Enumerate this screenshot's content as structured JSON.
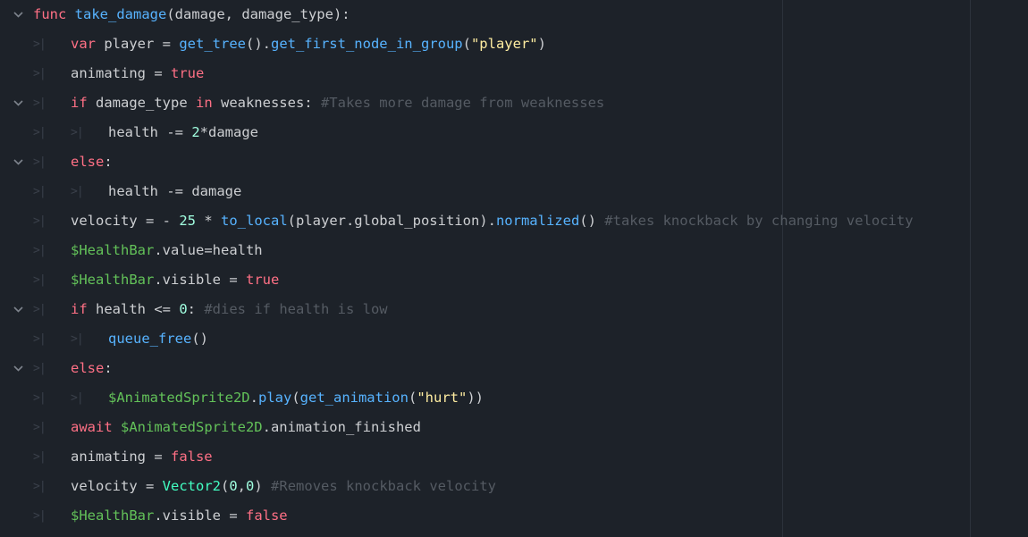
{
  "colors": {
    "background": "#1d2229",
    "text": "#cdcfd2",
    "keyword": "#ff7085",
    "function": "#57b3ff",
    "string": "#ffeda1",
    "number": "#a1ffe0",
    "comment": "#555b63",
    "node_path": "#63c259",
    "builtin_type": "#42ffc2",
    "tab_marker": "#3a404a"
  },
  "icons": {
    "fold": "chevron-down-icon",
    "tab": "tab-indent-marker"
  },
  "tab_glyph": ">|",
  "lines": [
    {
      "indent": 0,
      "fold": true,
      "tokens": [
        {
          "t": "func ",
          "c": "kw"
        },
        {
          "t": "take_damage",
          "c": "fn"
        },
        {
          "t": "(damage, damage_type):",
          "c": "txt"
        }
      ]
    },
    {
      "indent": 1,
      "fold": false,
      "tokens": [
        {
          "t": "var ",
          "c": "kw"
        },
        {
          "t": "player = ",
          "c": "txt"
        },
        {
          "t": "get_tree",
          "c": "fn"
        },
        {
          "t": "().",
          "c": "txt"
        },
        {
          "t": "get_first_node_in_group",
          "c": "fn"
        },
        {
          "t": "(",
          "c": "txt"
        },
        {
          "t": "\"player\"",
          "c": "str"
        },
        {
          "t": ")",
          "c": "txt"
        }
      ]
    },
    {
      "indent": 1,
      "fold": false,
      "tokens": [
        {
          "t": "animating = ",
          "c": "txt"
        },
        {
          "t": "true",
          "c": "kw"
        }
      ]
    },
    {
      "indent": 1,
      "fold": true,
      "tokens": [
        {
          "t": "if ",
          "c": "kw"
        },
        {
          "t": "damage_type ",
          "c": "txt"
        },
        {
          "t": "in ",
          "c": "kw"
        },
        {
          "t": "weaknesses: ",
          "c": "txt"
        },
        {
          "t": "#Takes more damage from weaknesses",
          "c": "cm"
        }
      ]
    },
    {
      "indent": 2,
      "fold": false,
      "tokens": [
        {
          "t": "health -= ",
          "c": "txt"
        },
        {
          "t": "2",
          "c": "num"
        },
        {
          "t": "*damage",
          "c": "txt"
        }
      ]
    },
    {
      "indent": 1,
      "fold": true,
      "tokens": [
        {
          "t": "else",
          "c": "kw"
        },
        {
          "t": ":",
          "c": "txt"
        }
      ]
    },
    {
      "indent": 2,
      "fold": false,
      "tokens": [
        {
          "t": "health -= damage",
          "c": "txt"
        }
      ]
    },
    {
      "indent": 1,
      "fold": false,
      "tokens": [
        {
          "t": "velocity = - ",
          "c": "txt"
        },
        {
          "t": "25",
          "c": "num"
        },
        {
          "t": " * ",
          "c": "txt"
        },
        {
          "t": "to_local",
          "c": "fn"
        },
        {
          "t": "(player.global_position).",
          "c": "txt"
        },
        {
          "t": "normalized",
          "c": "fn"
        },
        {
          "t": "() ",
          "c": "txt"
        },
        {
          "t": "#takes knockback by changing velocity",
          "c": "cm"
        }
      ]
    },
    {
      "indent": 1,
      "fold": false,
      "tokens": [
        {
          "t": "$HealthBar",
          "c": "node"
        },
        {
          "t": ".value=health",
          "c": "txt"
        }
      ]
    },
    {
      "indent": 1,
      "fold": false,
      "tokens": [
        {
          "t": "$HealthBar",
          "c": "node"
        },
        {
          "t": ".visible = ",
          "c": "txt"
        },
        {
          "t": "true",
          "c": "kw"
        }
      ]
    },
    {
      "indent": 1,
      "fold": true,
      "tokens": [
        {
          "t": "if ",
          "c": "kw"
        },
        {
          "t": "health <= ",
          "c": "txt"
        },
        {
          "t": "0",
          "c": "num"
        },
        {
          "t": ": ",
          "c": "txt"
        },
        {
          "t": "#dies if health is low",
          "c": "cm"
        }
      ]
    },
    {
      "indent": 2,
      "fold": false,
      "tokens": [
        {
          "t": "queue_free",
          "c": "fn"
        },
        {
          "t": "()",
          "c": "txt"
        }
      ]
    },
    {
      "indent": 1,
      "fold": true,
      "tokens": [
        {
          "t": "else",
          "c": "kw"
        },
        {
          "t": ":",
          "c": "txt"
        }
      ]
    },
    {
      "indent": 2,
      "fold": false,
      "tokens": [
        {
          "t": "$AnimatedSprite2D",
          "c": "node"
        },
        {
          "t": ".",
          "c": "txt"
        },
        {
          "t": "play",
          "c": "fn"
        },
        {
          "t": "(",
          "c": "txt"
        },
        {
          "t": "get_animation",
          "c": "fn"
        },
        {
          "t": "(",
          "c": "txt"
        },
        {
          "t": "\"hurt\"",
          "c": "str"
        },
        {
          "t": "))",
          "c": "txt"
        }
      ]
    },
    {
      "indent": 1,
      "fold": false,
      "tokens": [
        {
          "t": "await ",
          "c": "kw"
        },
        {
          "t": "$AnimatedSprite2D",
          "c": "node"
        },
        {
          "t": ".animation_finished",
          "c": "txt"
        }
      ]
    },
    {
      "indent": 1,
      "fold": false,
      "tokens": [
        {
          "t": "animating = ",
          "c": "txt"
        },
        {
          "t": "false",
          "c": "kw"
        }
      ]
    },
    {
      "indent": 1,
      "fold": false,
      "tokens": [
        {
          "t": "velocity = ",
          "c": "txt"
        },
        {
          "t": "Vector2",
          "c": "type"
        },
        {
          "t": "(",
          "c": "txt"
        },
        {
          "t": "0",
          "c": "num"
        },
        {
          "t": ",",
          "c": "txt"
        },
        {
          "t": "0",
          "c": "num"
        },
        {
          "t": ") ",
          "c": "txt"
        },
        {
          "t": "#Removes knockback velocity",
          "c": "cm"
        }
      ]
    },
    {
      "indent": 1,
      "fold": false,
      "tokens": [
        {
          "t": "$HealthBar",
          "c": "node"
        },
        {
          "t": ".visible = ",
          "c": "txt"
        },
        {
          "t": "false",
          "c": "kw"
        }
      ]
    }
  ]
}
